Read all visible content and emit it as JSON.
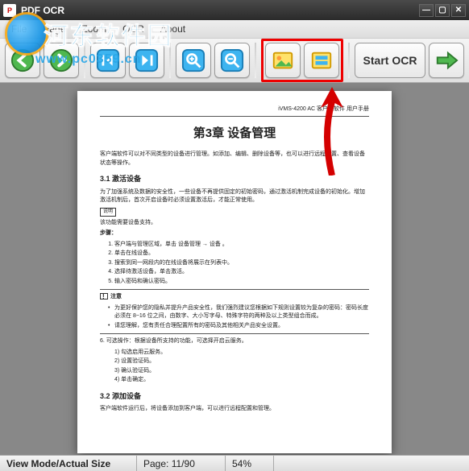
{
  "app": {
    "title": "PDF OCR"
  },
  "menus": {
    "file": "File",
    "page": "Page",
    "zoom": "Zoom",
    "ocr": "OCR",
    "about": "About"
  },
  "toolbar": {
    "start_ocr": "Start OCR"
  },
  "watermark": {
    "text": "河东软件园",
    "url": "www.pc0359.cn"
  },
  "document": {
    "header": "iVMS-4200 AC 客户端软件 用户手册",
    "chapter_title": "第3章 设备管理",
    "intro": "客户端软件可以对不同类型的设备进行管理。如添加、编辑、删除设备等，也可以进行远程配置、查看设备状态等操作。",
    "s31_title": "3.1 激活设备",
    "s31_p1": "为了加强系统及数据的安全性，一些设备不再提供固定的初始密码，通过激活机制完成设备的初始化。增加激活机制后，首次开启设备时必须设置激活后，才能正常使用。",
    "note_label": "说明",
    "s31_note": "该功能需要设备支持。",
    "steps_title": "步骤：",
    "s31_steps": [
      "客户端与管理区域，单击 设备管理 → 设备 。",
      "单击在线设备。",
      "搜索到同一网段内的在线设备将展示在列表中。",
      "选择待激活设备，单击激活。",
      "输入密码和确认密码。"
    ],
    "caution_label": "注意",
    "caution_b1": "为更好保护您的隐私并提升产品安全性，我们强烈建议您根据如下规则设置较为复杂的密码：密码长度必须在 8~16 位之间，由数字、大小写字母、特殊字符的两种及以上类型组合而成。",
    "caution_b2": "请您理解，您有责任合理配置所有的密码及其他相关产品安全设置。",
    "s31_after": "可选操作：根据设备所支持的功能，可选择开启云服务。",
    "opts": [
      "勾选启用云服务。",
      "设置验证码。",
      "确认验证码。",
      "单击确定。"
    ],
    "s32_title": "3.2 添加设备",
    "s32_p1": "客户端软件运行后，将设备添加到客户端，可以进行远程配置和管理。"
  },
  "statusbar": {
    "mode": "View Mode/Actual Size",
    "page_label": "Page:",
    "page_current": "11",
    "page_total": "90",
    "zoom": "54%"
  }
}
